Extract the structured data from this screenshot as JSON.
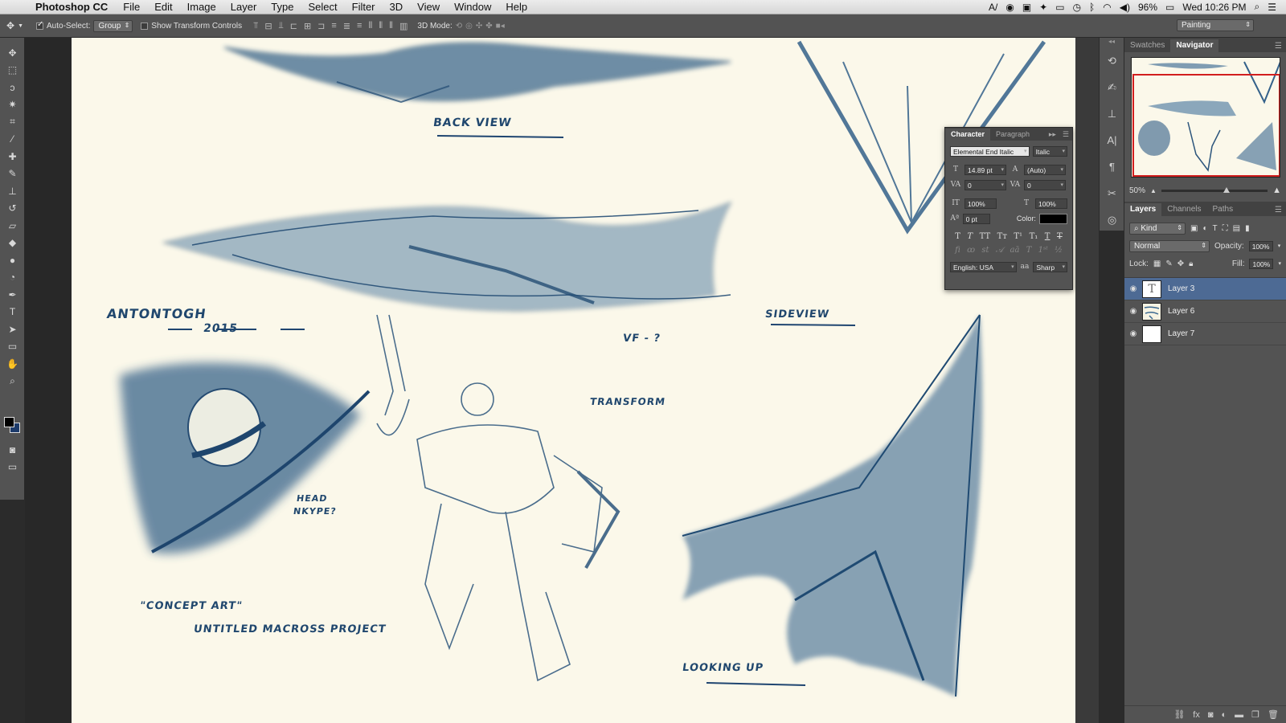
{
  "menubar": {
    "app_name": "Photoshop CC",
    "menus": [
      "File",
      "Edit",
      "Image",
      "Layer",
      "Type",
      "Select",
      "Filter",
      "3D",
      "View",
      "Window",
      "Help"
    ],
    "battery": "96%",
    "clock": "Wed 10:26 PM"
  },
  "options": {
    "auto_select_label": "Auto-Select:",
    "auto_select_value": "Group",
    "show_transform_label": "Show Transform Controls",
    "mode_label": "3D Mode:",
    "workspace": "Painting"
  },
  "colors": {
    "foreground": "#000000",
    "background": "#1c3a6a",
    "selected_layer": "#4d6a94",
    "sketch_ink": "#20476e"
  },
  "navigator": {
    "tabs": [
      "Swatches",
      "Navigator"
    ],
    "active_tab": "Navigator",
    "zoom": "50%"
  },
  "character": {
    "tabs": [
      "Character",
      "Paragraph"
    ],
    "active_tab": "Character",
    "font_family": "Elemental End Italic",
    "font_style": "Italic",
    "font_size": "14.89 pt",
    "leading": "(Auto)",
    "kerning": "0",
    "tracking": "0",
    "vertical_scale": "100%",
    "horizontal_scale": "100%",
    "baseline_shift": "0 pt",
    "color_label": "Color:",
    "language": "English: USA",
    "antialias_icon": "aa",
    "antialias": "Sharp"
  },
  "layers_panel": {
    "tabs": [
      "Layers",
      "Channels",
      "Paths"
    ],
    "active_tab": "Layers",
    "filter": "Kind",
    "blend_mode": "Normal",
    "opacity_label": "Opacity:",
    "opacity": "100%",
    "lock_label": "Lock:",
    "fill_label": "Fill:",
    "fill": "100%",
    "layers": [
      {
        "name": "Layer 3",
        "type": "text",
        "selected": true
      },
      {
        "name": "Layer 6",
        "type": "sketch",
        "selected": false
      },
      {
        "name": "Layer 7",
        "type": "blank",
        "selected": false
      }
    ]
  },
  "canvas_labels": {
    "back_view": "BACK VIEW",
    "side_view": "SIDEVIEW",
    "signature": "ANTONTOGH",
    "year": "2015",
    "vf": "VF - ?",
    "transform": "TRANSFORM",
    "head": "HEAD",
    "nkype": "NKYPE?",
    "concept_art": "\"CONCEPT ART\"",
    "project": "UNTITLED MACROSS PROJECT",
    "looking_up": "LOOKING UP"
  }
}
